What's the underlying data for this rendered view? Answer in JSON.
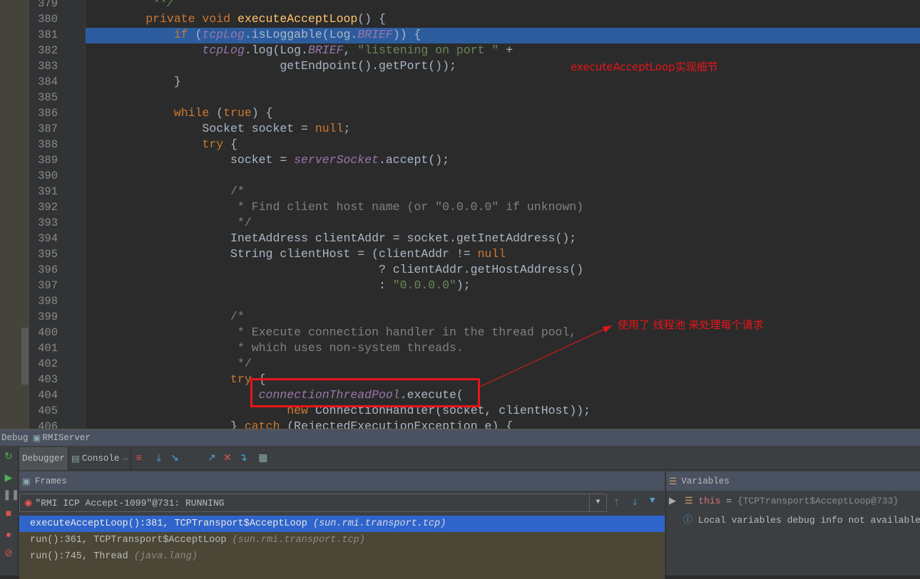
{
  "editor": {
    "current_line": 381,
    "lines": [
      {
        "n": "379",
        "t": [
          [
            "         **/",
            "doc"
          ]
        ]
      },
      {
        "n": "380",
        "t": [
          [
            "        ",
            ""
          ],
          [
            "private void ",
            "kw"
          ],
          [
            "executeAcceptLoop",
            "fn"
          ],
          [
            "() {",
            ""
          ]
        ]
      },
      {
        "n": "381",
        "t": [
          [
            "            ",
            ""
          ],
          [
            "if ",
            "kw"
          ],
          [
            "(",
            ""
          ],
          [
            "tcpLog",
            "fld"
          ],
          [
            ".isLoggable(Log.",
            ""
          ],
          [
            "BRIEF",
            "fld"
          ],
          [
            ")) {",
            ""
          ]
        ]
      },
      {
        "n": "382",
        "t": [
          [
            "                ",
            ""
          ],
          [
            "tcpLog",
            "fld"
          ],
          [
            ".log(Log.",
            ""
          ],
          [
            "BRIEF",
            "fld"
          ],
          [
            ", ",
            ""
          ],
          [
            "\"listening on port \"",
            "str"
          ],
          [
            " +",
            ""
          ]
        ]
      },
      {
        "n": "383",
        "t": [
          [
            "                           getEndpoint().getPort());",
            ""
          ]
        ]
      },
      {
        "n": "384",
        "t": [
          [
            "            }",
            ""
          ]
        ]
      },
      {
        "n": "385",
        "t": []
      },
      {
        "n": "386",
        "t": [
          [
            "            ",
            ""
          ],
          [
            "while ",
            "kw"
          ],
          [
            "(",
            ""
          ],
          [
            "true",
            "kw"
          ],
          [
            ") {",
            ""
          ]
        ]
      },
      {
        "n": "387",
        "t": [
          [
            "                Socket socket = ",
            ""
          ],
          [
            "null",
            "kw"
          ],
          [
            ";",
            ""
          ]
        ]
      },
      {
        "n": "388",
        "t": [
          [
            "                ",
            ""
          ],
          [
            "try ",
            "kw"
          ],
          [
            "{",
            ""
          ]
        ]
      },
      {
        "n": "389",
        "t": [
          [
            "                    socket = ",
            ""
          ],
          [
            "serverSocket",
            "fld"
          ],
          [
            ".accept();",
            ""
          ]
        ]
      },
      {
        "n": "390",
        "t": []
      },
      {
        "n": "391",
        "t": [
          [
            "                    /*",
            "cm"
          ]
        ]
      },
      {
        "n": "392",
        "t": [
          [
            "                     * Find client host name (or \"0.0.0.0\" if unknown)",
            "cm"
          ]
        ]
      },
      {
        "n": "393",
        "t": [
          [
            "                     */",
            "cm"
          ]
        ]
      },
      {
        "n": "394",
        "t": [
          [
            "                    InetAddress clientAddr = socket.getInetAddress();",
            ""
          ]
        ]
      },
      {
        "n": "395",
        "t": [
          [
            "                    String clientHost = (clientAddr != ",
            ""
          ],
          [
            "null",
            "kw"
          ]
        ]
      },
      {
        "n": "396",
        "t": [
          [
            "                                         ? clientAddr.getHostAddress()",
            ""
          ]
        ]
      },
      {
        "n": "397",
        "t": [
          [
            "                                         : ",
            ""
          ],
          [
            "\"0.0.0.0\"",
            "str"
          ],
          [
            ");",
            ""
          ]
        ]
      },
      {
        "n": "398",
        "t": []
      },
      {
        "n": "399",
        "t": [
          [
            "                    /*",
            "cm"
          ]
        ]
      },
      {
        "n": "400",
        "t": [
          [
            "                     * Execute connection handler in the thread pool,",
            "cm"
          ]
        ]
      },
      {
        "n": "401",
        "t": [
          [
            "                     * which uses non-system threads.",
            "cm"
          ]
        ]
      },
      {
        "n": "402",
        "t": [
          [
            "                     */",
            "cm"
          ]
        ]
      },
      {
        "n": "403",
        "t": [
          [
            "                    ",
            ""
          ],
          [
            "try ",
            "kw"
          ],
          [
            "{",
            ""
          ]
        ]
      },
      {
        "n": "404",
        "t": [
          [
            "                        ",
            ""
          ],
          [
            "connectionThreadPool",
            "fld"
          ],
          [
            ".execute(",
            ""
          ]
        ]
      },
      {
        "n": "405",
        "t": [
          [
            "                            ",
            ""
          ],
          [
            "new ",
            "kw"
          ],
          [
            "ConnectionHandler(socket, clientHost));",
            ""
          ]
        ]
      },
      {
        "n": "406",
        "t": [
          [
            "                    } ",
            ""
          ],
          [
            "catch ",
            "kw"
          ],
          [
            "(RejectedExecutionException e) {",
            ""
          ]
        ]
      }
    ]
  },
  "annotations": {
    "note1": "executeAcceptLoop实现细节",
    "note2": "使用了 线程池 来处理每个请求",
    "color": "#e8151a"
  },
  "debug": {
    "title": "Debug",
    "config": "RMIServer",
    "tabs": {
      "debugger": "Debugger",
      "console": "Console"
    },
    "frames_title": "Frames",
    "variables_title": "Variables",
    "thread": "\"RMI ICP Accept-1099\"@731: RUNNING",
    "frames": [
      {
        "m": "executeAcceptLoop():381, TCPTransport$AcceptLoop ",
        "p": "(sun.rmi.transport.tcp)",
        "selected": true
      },
      {
        "m": "run():361, TCPTransport$AcceptLoop ",
        "p": "(sun.rmi.transport.tcp)"
      },
      {
        "m": "run():745, Thread ",
        "p": "(java.lang)"
      }
    ],
    "vars": {
      "name": "this",
      "eq": " = ",
      "value": "{TCPTransport$AcceptLoop@733}",
      "info": "Local variables debug info not available"
    },
    "selection_color": "#2f65ca"
  }
}
